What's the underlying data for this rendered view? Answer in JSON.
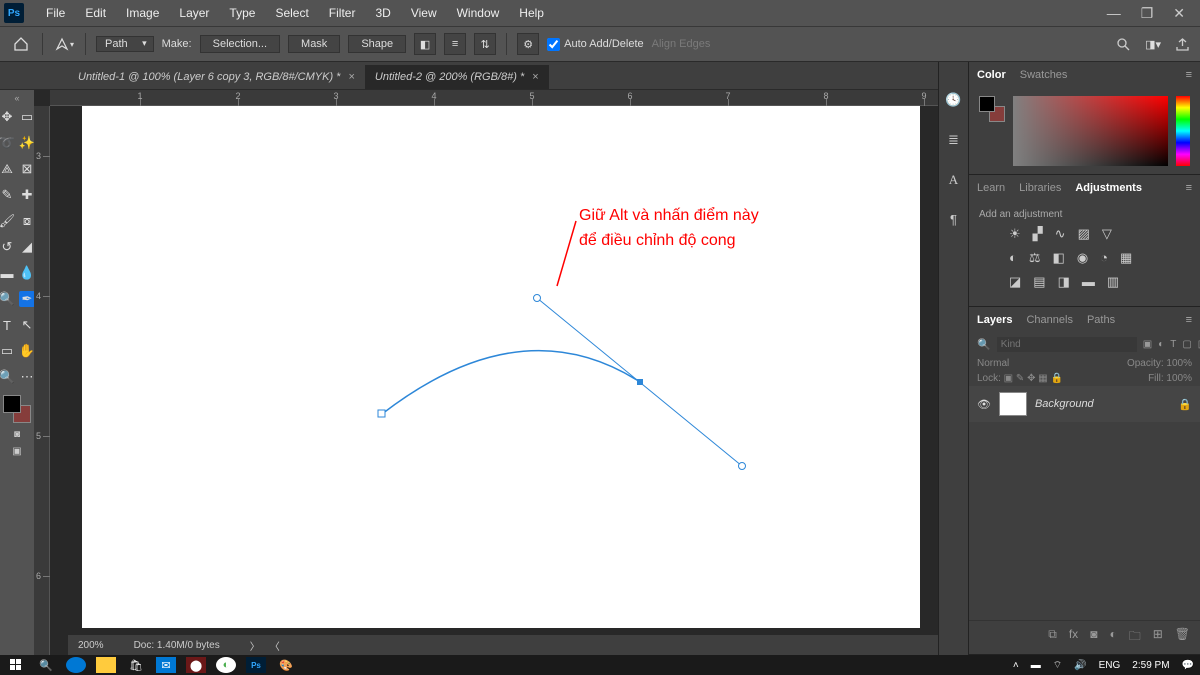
{
  "menubar": [
    "File",
    "Edit",
    "Image",
    "Layer",
    "Type",
    "Select",
    "Filter",
    "3D",
    "View",
    "Window",
    "Help"
  ],
  "optbar": {
    "path_mode": "Path",
    "make": "Make:",
    "selection": "Selection...",
    "mask": "Mask",
    "shape": "Shape",
    "auto": "Auto Add/Delete",
    "align": "Align Edges"
  },
  "tabs": [
    {
      "label": "Untitled-1 @ 100% (Layer 6 copy 3, RGB/8#/CMYK) *",
      "active": false
    },
    {
      "label": "Untitled-2 @ 200% (RGB/8#) *",
      "active": true
    }
  ],
  "annotation": {
    "line1": "Giữ Alt và nhấn điểm này",
    "line2": "để điều chỉnh độ cong"
  },
  "status": {
    "zoom": "200%",
    "doc": "Doc: 1.40M/0 bytes"
  },
  "ruler_h": [
    "1",
    "2",
    "3",
    "4",
    "5",
    "6",
    "7",
    "8",
    "9"
  ],
  "ruler_v": [
    "3",
    "4",
    "5",
    "6"
  ],
  "panels": {
    "color_tabs": [
      "Color",
      "Swatches"
    ],
    "adj_tabs": [
      "Learn",
      "Libraries",
      "Adjustments"
    ],
    "adj_hint": "Add an adjustment",
    "layers_tabs": [
      "Layers",
      "Channels",
      "Paths"
    ],
    "kind_ph": "Kind",
    "blend": "Normal",
    "opacity_lbl": "Opacity:",
    "opacity_val": "100%",
    "lock_lbl": "Lock:",
    "fill_lbl": "Fill:",
    "fill_val": "100%",
    "layer_name": "Background"
  },
  "taskbar": {
    "lang": "ENG",
    "time": "2:59 PM"
  }
}
